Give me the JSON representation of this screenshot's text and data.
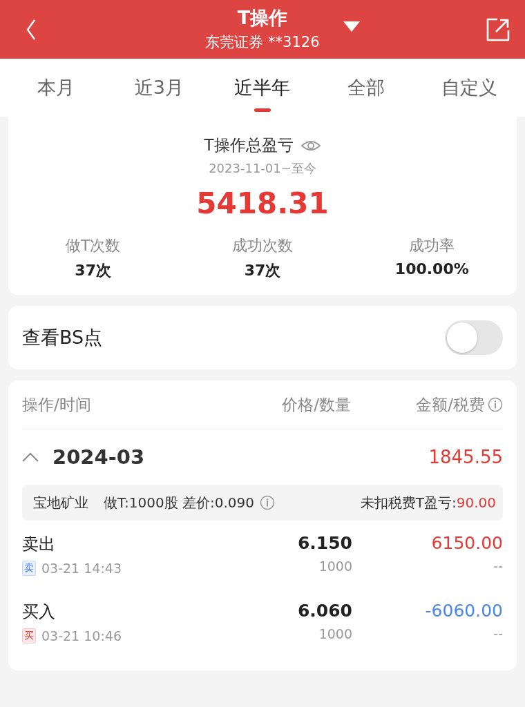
{
  "header": {
    "title": "T操作",
    "account": "东莞证券 **3126"
  },
  "tabs": [
    {
      "label": "本月",
      "selected": false
    },
    {
      "label": "近3月",
      "selected": false
    },
    {
      "label": "近半年",
      "selected": true
    },
    {
      "label": "全部",
      "selected": false
    },
    {
      "label": "自定义",
      "selected": false
    }
  ],
  "summary": {
    "title": "T操作总盈亏",
    "period": "2023-11-01~至今",
    "total": "5418.31",
    "stats": [
      {
        "label": "做T次数",
        "value": "37次"
      },
      {
        "label": "成功次数",
        "value": "37次"
      },
      {
        "label": "成功率",
        "value": "100.00%"
      }
    ]
  },
  "bs_toggle": {
    "label": "查看BS点",
    "on": false
  },
  "table": {
    "columns": [
      "操作/时间",
      "价格/数量",
      "金额/税费"
    ],
    "groups": [
      {
        "month": "2024-03",
        "total": "1845.55",
        "expanded": true,
        "stock": {
          "name": "宝地矿业",
          "t_info": "做T:1000股 差价:0.090",
          "profit_label": "未扣税费T盈亏:",
          "profit": "90.00"
        },
        "trades": [
          {
            "kind": "sell",
            "action": "卖出",
            "badge": "卖",
            "time": "03-21 14:43",
            "price": "6.150",
            "quantity": "1000",
            "amount": "6150.00",
            "fee": "--"
          },
          {
            "kind": "buy",
            "action": "买入",
            "badge": "买",
            "time": "03-21 10:46",
            "price": "6.060",
            "quantity": "1000",
            "amount": "-6060.00",
            "fee": "--"
          }
        ]
      }
    ]
  }
}
